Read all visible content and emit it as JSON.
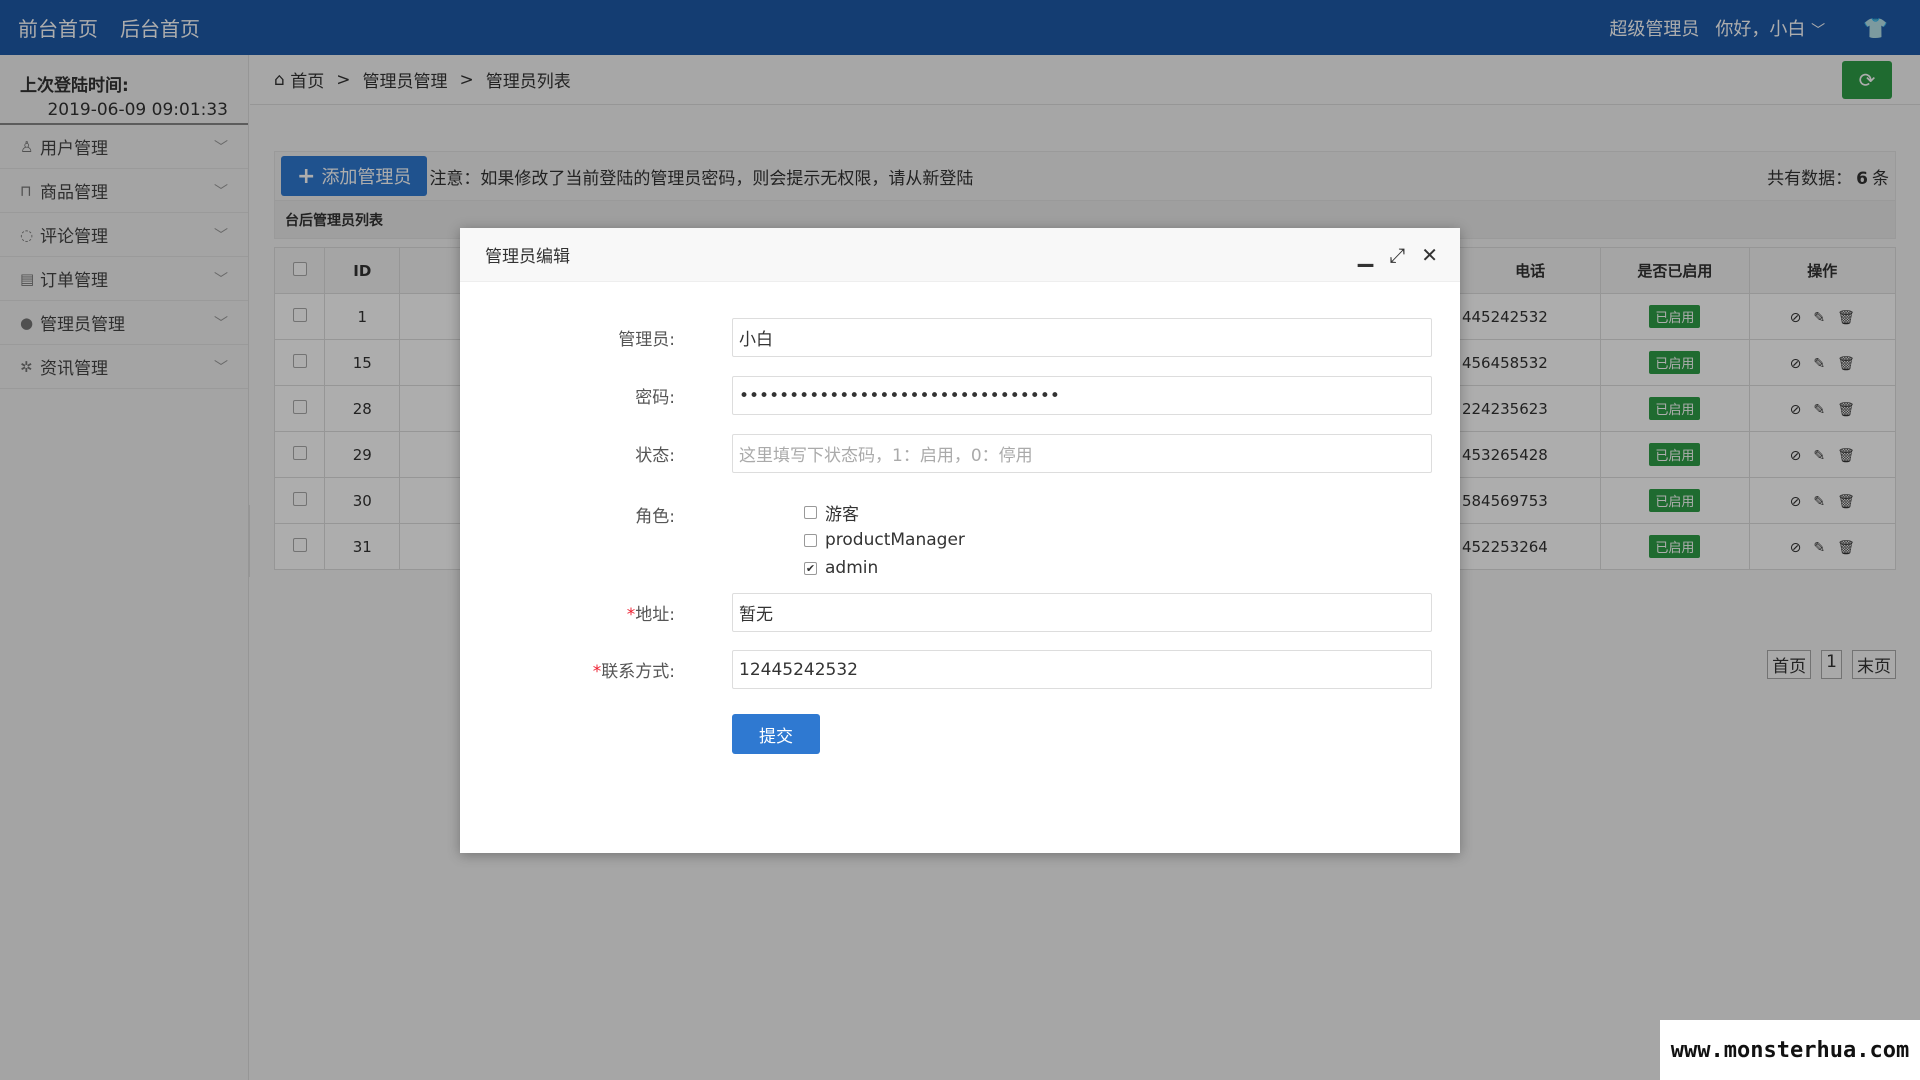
{
  "topbar": {
    "links": [
      "前台首页",
      "后台首页"
    ],
    "role": "超级管理员",
    "greeting": "你好，小白"
  },
  "sidebar": {
    "last_login_label": "上次登陆时间:",
    "last_login_time": "2019-06-09 09:01:33",
    "items": [
      {
        "label": "用户管理",
        "icon": "user-icon"
      },
      {
        "label": "商品管理",
        "icon": "bag-icon"
      },
      {
        "label": "评论管理",
        "icon": "comment-icon"
      },
      {
        "label": "订单管理",
        "icon": "order-icon"
      },
      {
        "label": "管理员管理",
        "icon": "admin-icon"
      },
      {
        "label": "资讯管理",
        "icon": "gear-icon"
      }
    ]
  },
  "breadcrumb": [
    "首页",
    "管理员管理",
    "管理员列表"
  ],
  "toolbar": {
    "add_label": "添加管理员",
    "notice": "注意：如果修改了当前登陆的管理员密码，则会提示无权限，请从新登陆",
    "total_prefix": "共有数据：",
    "total_count": "6",
    "total_suffix": "条"
  },
  "table": {
    "title": "台后管理员列表",
    "headers": {
      "id": "ID",
      "phone": "电话",
      "enabled": "是否已启用",
      "ops": "操作"
    },
    "rows": [
      {
        "id": "1",
        "phone": "445242532",
        "status": "已启用"
      },
      {
        "id": "15",
        "phone": "456458532",
        "status": "已启用"
      },
      {
        "id": "28",
        "phone": "224235623",
        "status": "已启用"
      },
      {
        "id": "29",
        "phone": "453265428",
        "status": "已启用"
      },
      {
        "id": "30",
        "phone": "584569753",
        "status": "已启用"
      },
      {
        "id": "31",
        "phone": "452253264",
        "status": "已启用"
      }
    ]
  },
  "pager": {
    "first": "首页",
    "page": "1",
    "last": "末页"
  },
  "modal": {
    "title": "管理员编辑",
    "admin_label": "管理员:",
    "admin_value": "小白",
    "password_label": "密码:",
    "password_value": "••••••••••••••••••••••••••••••••",
    "status_label": "状态:",
    "status_placeholder": "这里填写下状态码，1：启用，0：停用",
    "role_label": "角色:",
    "roles": [
      {
        "name": "游客",
        "checked": false
      },
      {
        "name": "productManager",
        "checked": false
      },
      {
        "name": "admin",
        "checked": true
      }
    ],
    "address_label": "地址:",
    "address_value": "暂无",
    "contact_label": "联系方式:",
    "contact_value": "12445242532",
    "submit_label": "提交"
  },
  "watermark": "www.monsterhua.com"
}
